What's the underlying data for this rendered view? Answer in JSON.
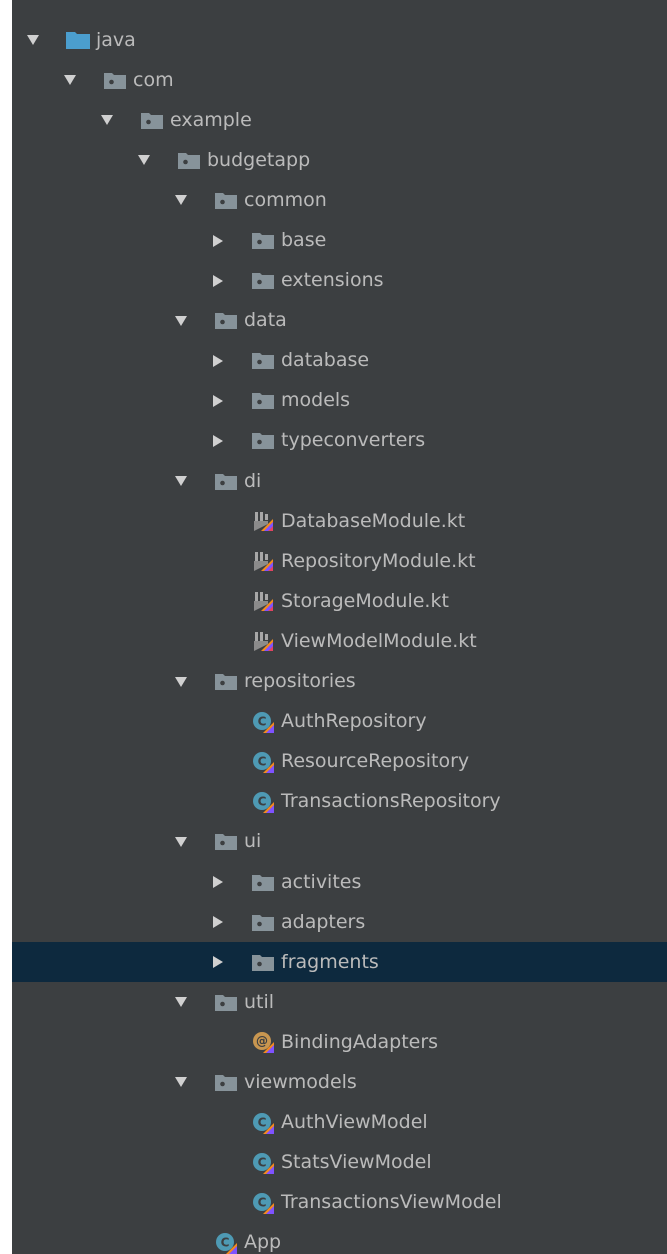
{
  "tree": {
    "selected_index": 23,
    "colors": {
      "panel_bg": "#3c3f41",
      "text": "#bbbbbb",
      "selection_bg": "#0d293e",
      "folder": "#87939a",
      "source_folder": "#4b9ece",
      "kotlin_class": "#4e9ab4",
      "kotlin_annotation": "#c89650"
    },
    "items": [
      {
        "label": "java",
        "depth": 0,
        "type": "source-folder",
        "arrow": "down"
      },
      {
        "label": "com",
        "depth": 1,
        "type": "package",
        "arrow": "down"
      },
      {
        "label": "example",
        "depth": 2,
        "type": "package",
        "arrow": "down"
      },
      {
        "label": "budgetapp",
        "depth": 3,
        "type": "package",
        "arrow": "down"
      },
      {
        "label": "common",
        "depth": 4,
        "type": "package",
        "arrow": "down"
      },
      {
        "label": "base",
        "depth": 5,
        "type": "package",
        "arrow": "right"
      },
      {
        "label": "extensions",
        "depth": 5,
        "type": "package",
        "arrow": "right"
      },
      {
        "label": "data",
        "depth": 4,
        "type": "package",
        "arrow": "down"
      },
      {
        "label": "database",
        "depth": 5,
        "type": "package",
        "arrow": "right"
      },
      {
        "label": "models",
        "depth": 5,
        "type": "package",
        "arrow": "right"
      },
      {
        "label": "typeconverters",
        "depth": 5,
        "type": "package",
        "arrow": "right"
      },
      {
        "label": "di",
        "depth": 4,
        "type": "package",
        "arrow": "down"
      },
      {
        "label": "DatabaseModule.kt",
        "depth": 5,
        "type": "kotlin-file",
        "arrow": "none"
      },
      {
        "label": "RepositoryModule.kt",
        "depth": 5,
        "type": "kotlin-file",
        "arrow": "none"
      },
      {
        "label": "StorageModule.kt",
        "depth": 5,
        "type": "kotlin-file",
        "arrow": "none"
      },
      {
        "label": "ViewModelModule.kt",
        "depth": 5,
        "type": "kotlin-file",
        "arrow": "none"
      },
      {
        "label": "repositories",
        "depth": 4,
        "type": "package",
        "arrow": "down"
      },
      {
        "label": "AuthRepository",
        "depth": 5,
        "type": "kotlin-class",
        "arrow": "none"
      },
      {
        "label": "ResourceRepository",
        "depth": 5,
        "type": "kotlin-class",
        "arrow": "none"
      },
      {
        "label": "TransactionsRepository",
        "depth": 5,
        "type": "kotlin-class",
        "arrow": "none"
      },
      {
        "label": "ui",
        "depth": 4,
        "type": "package",
        "arrow": "down"
      },
      {
        "label": "activites",
        "depth": 5,
        "type": "package",
        "arrow": "right"
      },
      {
        "label": "adapters",
        "depth": 5,
        "type": "package",
        "arrow": "right"
      },
      {
        "label": "fragments",
        "depth": 5,
        "type": "package",
        "arrow": "right"
      },
      {
        "label": "util",
        "depth": 4,
        "type": "package",
        "arrow": "down"
      },
      {
        "label": "BindingAdapters",
        "depth": 5,
        "type": "kotlin-annotation",
        "arrow": "none"
      },
      {
        "label": "viewmodels",
        "depth": 4,
        "type": "package",
        "arrow": "down"
      },
      {
        "label": "AuthViewModel",
        "depth": 5,
        "type": "kotlin-class",
        "arrow": "none"
      },
      {
        "label": "StatsViewModel",
        "depth": 5,
        "type": "kotlin-class",
        "arrow": "none"
      },
      {
        "label": "TransactionsViewModel",
        "depth": 5,
        "type": "kotlin-class",
        "arrow": "none"
      },
      {
        "label": "App",
        "depth": 4,
        "type": "kotlin-class",
        "arrow": "none"
      }
    ]
  }
}
